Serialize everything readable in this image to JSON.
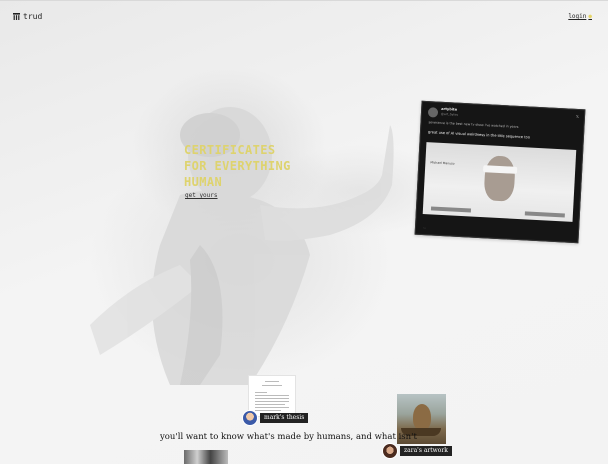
{
  "header": {
    "logo_text": "trud",
    "logo_icon": "trud-logo-icon",
    "login_label": "login",
    "login_dot_color": "#e5d56a"
  },
  "hero": {
    "title_lines": [
      "CERTIFICATES",
      "FOR EVERYTHING",
      "HUMAN"
    ],
    "title_color": "#ded36e",
    "cta_label": "get yours"
  },
  "tweet": {
    "name": "artybite",
    "handle": "@art_bytes",
    "quote": "severance is the best new tv show i've watched in years",
    "text": "great use of AI visual weirdness in the title sequence too",
    "caption": "Michael Manuso"
  },
  "showcase": {
    "thesis_label": "mark's thesis",
    "artwork_label": "zara's artwork",
    "tagline": "you'll want to know what's made by humans, and what isn't"
  }
}
